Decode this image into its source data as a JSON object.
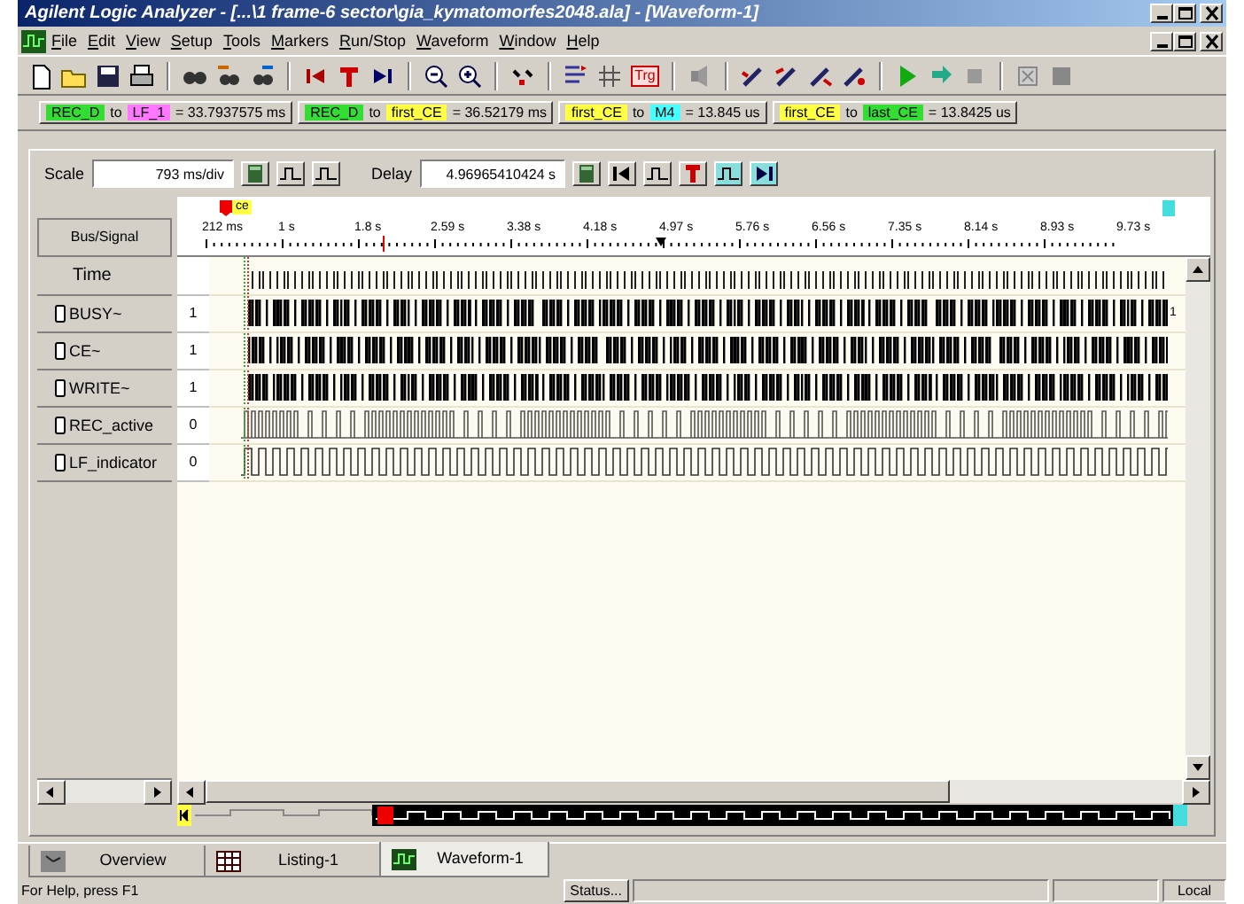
{
  "window": {
    "title": "Agilent Logic Analyzer - [...\\1 frame-6 sector\\gia_kymatomorfes2048.ala] - [Waveform-1]"
  },
  "menu": [
    "File",
    "Edit",
    "View",
    "Setup",
    "Tools",
    "Markers",
    "Run/Stop",
    "Waveform",
    "Window",
    "Help"
  ],
  "toolbar": {
    "trigger_label": "Trg"
  },
  "measurements": [
    {
      "from": {
        "label": "REC_D",
        "color": "#33dd33"
      },
      "connector": "to",
      "to": {
        "label": "LF_1",
        "color": "#ff77ff"
      },
      "value": "= 33.7937575 ms"
    },
    {
      "from": {
        "label": "REC_D",
        "color": "#33dd33"
      },
      "connector": "to",
      "to": {
        "label": "first_CE",
        "color": "#ffff44"
      },
      "value": "= 36.52179 ms"
    },
    {
      "from": {
        "label": "first_CE",
        "color": "#ffff44"
      },
      "connector": "to",
      "to": {
        "label": "M4",
        "color": "#44ffff"
      },
      "value": "= 13.845 us"
    },
    {
      "from": {
        "label": "first_CE",
        "color": "#ffff44"
      },
      "connector": "to",
      "to": {
        "label": "last_CE",
        "color": "#33dd33"
      },
      "value": "= 13.8425 us"
    }
  ],
  "scale": {
    "label": "Scale",
    "value": "793 ms/div"
  },
  "delay": {
    "label": "Delay",
    "value": "4.96965410424 s"
  },
  "marker": {
    "label": "ce"
  },
  "header": "Bus/Signal",
  "ticks": [
    "212 ms",
    "1 s",
    "1.8 s",
    "2.59 s",
    "3.38 s",
    "4.18 s",
    "4.97 s",
    "5.76 s",
    "6.56 s",
    "7.35 s",
    "8.14 s",
    "8.93 s",
    "9.73 s"
  ],
  "signals": [
    {
      "name": "Time",
      "kind": "time"
    },
    {
      "name": "BUSY~",
      "kind": "dense",
      "value": "1",
      "end_value": "1"
    },
    {
      "name": "CE~",
      "kind": "dense",
      "value": "1"
    },
    {
      "name": "WRITE~",
      "kind": "dense",
      "value": "1"
    },
    {
      "name": "REC_active",
      "kind": "pulse",
      "value": "0"
    },
    {
      "name": "LF_indicator",
      "kind": "square",
      "value": "0"
    }
  ],
  "tabs": [
    {
      "label": "Overview",
      "kind": "overview",
      "selected": false
    },
    {
      "label": "Listing-1",
      "kind": "listing",
      "selected": false
    },
    {
      "label": "Waveform-1",
      "kind": "waveform",
      "selected": true
    }
  ],
  "status": {
    "help": "For Help, press F1",
    "state": "Status...",
    "mode": "Local"
  }
}
